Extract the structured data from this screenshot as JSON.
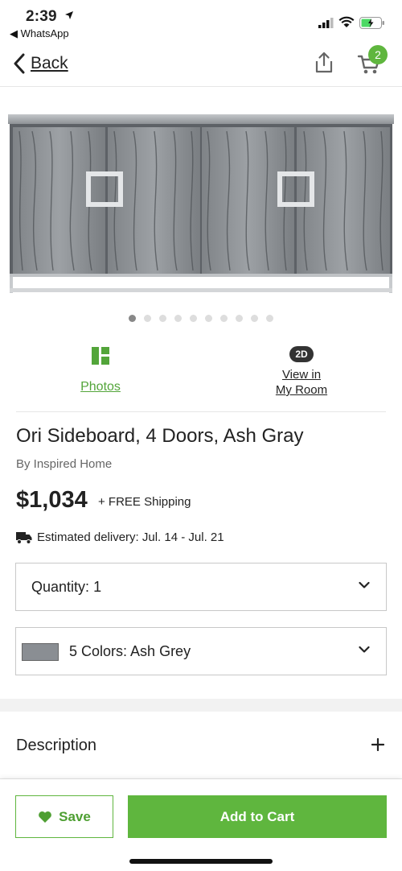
{
  "status_bar": {
    "time": "2:39",
    "back_app": "◀ WhatsApp",
    "icons": [
      "location-arrow-icon",
      "cellular-signal-icon",
      "wifi-icon",
      "battery-charging-icon"
    ]
  },
  "nav": {
    "back_label": "Back",
    "cart_count": "2",
    "icons": [
      "chevron-left-icon",
      "share-icon",
      "cart-icon"
    ]
  },
  "gallery": {
    "image": "product-image",
    "dot_count": 10,
    "active_index": 0
  },
  "view_options": {
    "photos_label": "Photos",
    "room_badge": "2D",
    "room_label_line1": "View in",
    "room_label_line2": "My Room"
  },
  "product": {
    "title": "Ori Sideboard, 4 Doors, Ash Gray",
    "brand": "By Inspired Home",
    "price": "$1,034",
    "shipping": "+ FREE Shipping",
    "delivery": "Estimated delivery: Jul. 14 - Jul. 21"
  },
  "options": {
    "quantity_label": "Quantity:",
    "quantity_value": "1",
    "color_label": "5 Colors:",
    "color_value": "Ash Grey"
  },
  "description": {
    "label": "Description"
  },
  "actions": {
    "save_label": "Save",
    "add_to_cart_label": "Add to Cart"
  },
  "colors": {
    "accent": "#5fb63e",
    "link_green": "#53a53a",
    "text": "#222222"
  }
}
